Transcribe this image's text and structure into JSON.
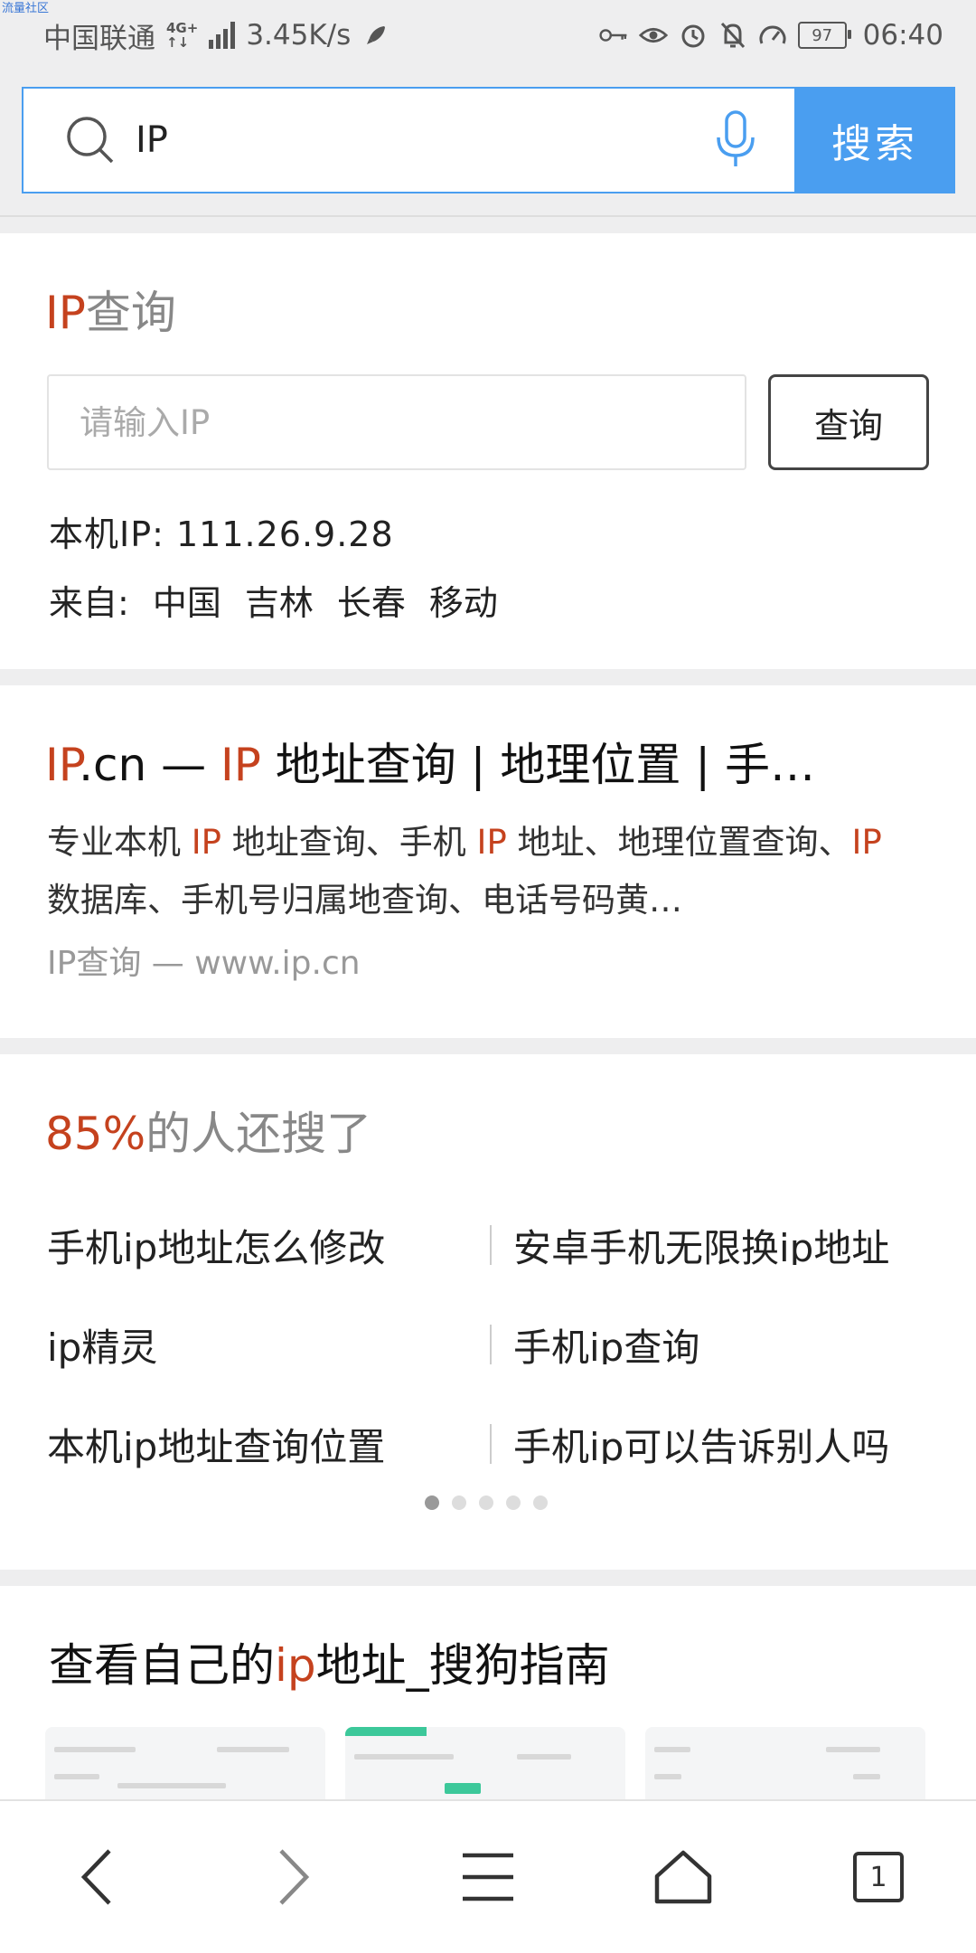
{
  "watermark": "流量社区",
  "status": {
    "carrier": "中国联通",
    "network_line1": "4G+",
    "network_line2": "↑↓",
    "speed": "3.45K/s",
    "battery": "97",
    "time": "06:40"
  },
  "search": {
    "query": "IP",
    "button_label": "搜索"
  },
  "ip_card": {
    "title_hl": "IP",
    "title_rest": "查询",
    "input_placeholder": "请输入IP",
    "query_button": "查询",
    "local_ip": "本机IP: 111.26.9.28",
    "origin_label": "来自:",
    "origin_parts": [
      "中国",
      "吉林",
      "长春",
      "移动"
    ]
  },
  "result": {
    "title_parts": [
      {
        "t": "IP",
        "hl": true
      },
      {
        "t": ".cn — ",
        "hl": false
      },
      {
        "t": "IP",
        "hl": true
      },
      {
        "t": " 地址查询 | 地理位置 | 手…",
        "hl": false
      }
    ],
    "desc_parts": [
      {
        "t": "专业本机 ",
        "hl": false
      },
      {
        "t": "IP",
        "hl": true
      },
      {
        "t": " 地址查询、手机 ",
        "hl": false
      },
      {
        "t": "IP",
        "hl": true
      },
      {
        "t": " 地址、地理位置查询、",
        "hl": false
      },
      {
        "t": "IP",
        "hl": true
      },
      {
        "t": " 数据库、手机号归属地查询、电话号码黄…",
        "hl": false
      }
    ],
    "source": "IP查询 — www.ip.cn"
  },
  "related": {
    "title_hl": "85%",
    "title_rest": "的人还搜了",
    "rows": [
      [
        "手机ip地址怎么修改",
        "安卓手机无限换ip地址"
      ],
      [
        "ip精灵",
        "手机ip查询"
      ],
      [
        "本机ip地址查询位置",
        "手机ip可以告诉别人吗"
      ]
    ]
  },
  "guide": {
    "title_parts": [
      {
        "t": "查看自己的",
        "hl": false
      },
      {
        "t": "ip",
        "hl": true
      },
      {
        "t": "地址_搜狗指南",
        "hl": false
      }
    ]
  },
  "nav": {
    "tab_count": "1"
  },
  "colors": {
    "accent": "#4a9ef0",
    "highlight": "#c5421e"
  }
}
